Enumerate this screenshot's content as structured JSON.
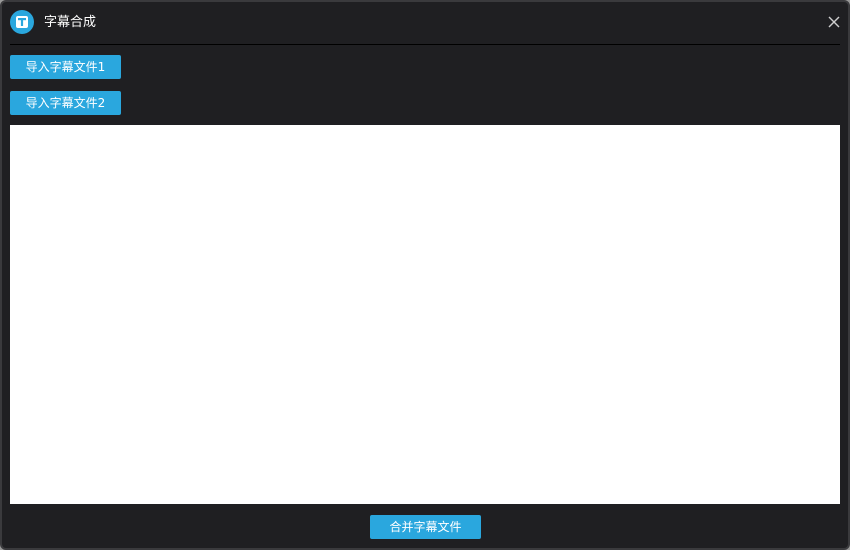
{
  "window": {
    "title": "字幕合成",
    "app_icon": "text-t-icon",
    "close_icon": "close-icon"
  },
  "toolbar": {
    "import1_label": "导入字幕文件1",
    "import2_label": "导入字幕文件2"
  },
  "footer": {
    "merge_label": "合并字幕文件"
  },
  "colors": {
    "accent": "#2aa7de",
    "background": "#1f1f22",
    "content": "#ffffff"
  }
}
